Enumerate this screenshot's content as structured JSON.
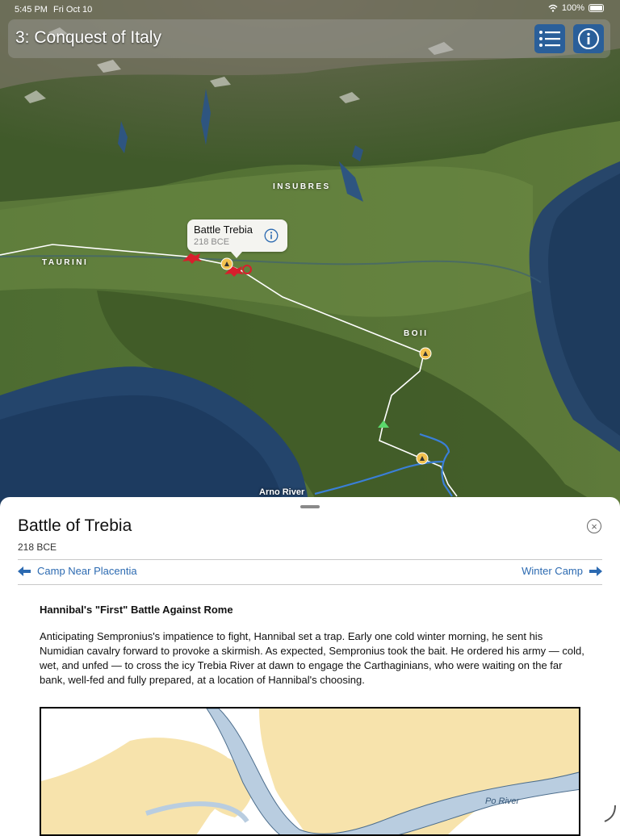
{
  "status_bar": {
    "time": "5:45 PM",
    "date": "Fri Oct 10",
    "battery": "100%"
  },
  "header": {
    "title": "3: Conquest of Italy",
    "list_icon": "list-icon",
    "info_icon": "info-icon"
  },
  "map": {
    "regions": [
      "INSUBRES",
      "TAURINI",
      "BOII"
    ],
    "river_label": "Arno River",
    "callout": {
      "title": "Battle Trebia",
      "subtitle": "218 BCE",
      "icon": "info-icon"
    }
  },
  "sheet": {
    "title": "Battle of Trebia",
    "subtitle": "218 BCE",
    "prev_label": "Camp Near Placentia",
    "next_label": "Winter Camp",
    "heading": "Hannibal's \"First\" Battle Against Rome",
    "paragraph": "Anticipating Sempronius's impatience to fight, Hannibal set a trap. Early one cold winter morning, he sent his Numidian cavalry forward to provoke a skirmish. As expected, Sempronius took the bait. He ordered his army — cold, wet, and unfed — to cross the icy Trebia River at dawn to engage the Carthaginians, who were waiting on the far bank, well-fed and fully prepared, at a location of Hannibal's choosing.",
    "inset_map": {
      "river_label": "Po River"
    }
  },
  "colors": {
    "accent": "#2c6ab1",
    "land": "#f7e3ac",
    "water": "#b9cde0",
    "route": "#ffffff",
    "river": "#3a7fd8",
    "battle": "#d81e2c",
    "camp": "#f2c14e"
  }
}
